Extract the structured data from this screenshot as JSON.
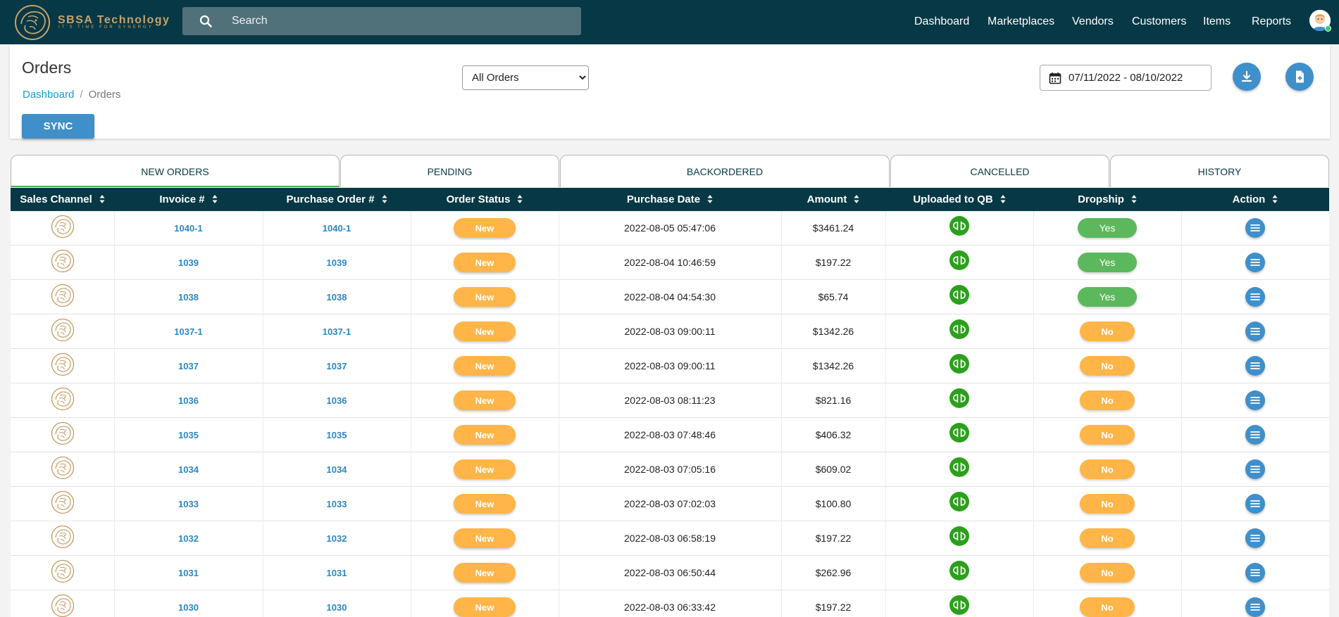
{
  "brand": {
    "name": "SBSA Technology",
    "tagline": "IT'S TIME FOR SYNERGY"
  },
  "search": {
    "placeholder": "Search"
  },
  "nav": {
    "items": [
      "Dashboard",
      "Marketplaces",
      "Vendors",
      "Customers",
      "Items",
      "Reports"
    ]
  },
  "page": {
    "title": "Orders",
    "breadcrumb": [
      "Dashboard",
      "Orders"
    ],
    "sync_label": "SYNC",
    "filter": {
      "selected": "All Orders"
    },
    "date_range": "07/11/2022 - 08/10/2022"
  },
  "tabs": [
    "NEW ORDERS",
    "PENDING",
    "BACKORDERED",
    "CANCELLED",
    "HISTORY"
  ],
  "table": {
    "columns": [
      "Sales Channel",
      "Invoice #",
      "Purchase Order #",
      "Order Status",
      "Purchase Date",
      "Amount",
      "Uploaded to QB",
      "Dropship",
      "Action"
    ],
    "rows": [
      {
        "invoice": "1040-1",
        "po": "1040-1",
        "status": "New",
        "date": "2022-08-05 05:47:06",
        "amount": "$3461.24",
        "dropship": "Yes"
      },
      {
        "invoice": "1039",
        "po": "1039",
        "status": "New",
        "date": "2022-08-04 10:46:59",
        "amount": "$197.22",
        "dropship": "Yes"
      },
      {
        "invoice": "1038",
        "po": "1038",
        "status": "New",
        "date": "2022-08-04 04:54:30",
        "amount": "$65.74",
        "dropship": "Yes"
      },
      {
        "invoice": "1037-1",
        "po": "1037-1",
        "status": "New",
        "date": "2022-08-03 09:00:11",
        "amount": "$1342.26",
        "dropship": "No"
      },
      {
        "invoice": "1037",
        "po": "1037",
        "status": "New",
        "date": "2022-08-03 09:00:11",
        "amount": "$1342.26",
        "dropship": "No"
      },
      {
        "invoice": "1036",
        "po": "1036",
        "status": "New",
        "date": "2022-08-03 08:11:23",
        "amount": "$821.16",
        "dropship": "No"
      },
      {
        "invoice": "1035",
        "po": "1035",
        "status": "New",
        "date": "2022-08-03 07:48:46",
        "amount": "$406.32",
        "dropship": "No"
      },
      {
        "invoice": "1034",
        "po": "1034",
        "status": "New",
        "date": "2022-08-03 07:05:16",
        "amount": "$609.02",
        "dropship": "No"
      },
      {
        "invoice": "1033",
        "po": "1033",
        "status": "New",
        "date": "2022-08-03 07:02:03",
        "amount": "$100.80",
        "dropship": "No"
      },
      {
        "invoice": "1032",
        "po": "1032",
        "status": "New",
        "date": "2022-08-03 06:58:19",
        "amount": "$197.22",
        "dropship": "No"
      },
      {
        "invoice": "1031",
        "po": "1031",
        "status": "New",
        "date": "2022-08-03 06:50:44",
        "amount": "$262.96",
        "dropship": "No"
      },
      {
        "invoice": "1030",
        "po": "1030",
        "status": "New",
        "date": "2022-08-03 06:33:42",
        "amount": "$197.22",
        "dropship": "No"
      }
    ]
  },
  "icons": {
    "search": "search-icon",
    "calendar": "calendar-icon",
    "download": "download-icon",
    "export": "file-plus-icon",
    "sort": "sort-icon",
    "qb": "quickbooks-icon",
    "action": "menu-icon",
    "channel": "lion-logo-icon"
  },
  "colors": {
    "navbar": "#073845",
    "accent": "#3f8fca",
    "status_new": "#ffb547",
    "dropship_yes": "#5cb85c",
    "quickbooks": "#2ca01c",
    "active_tab_underline": "#4caf50",
    "link": "#2d86c2"
  }
}
